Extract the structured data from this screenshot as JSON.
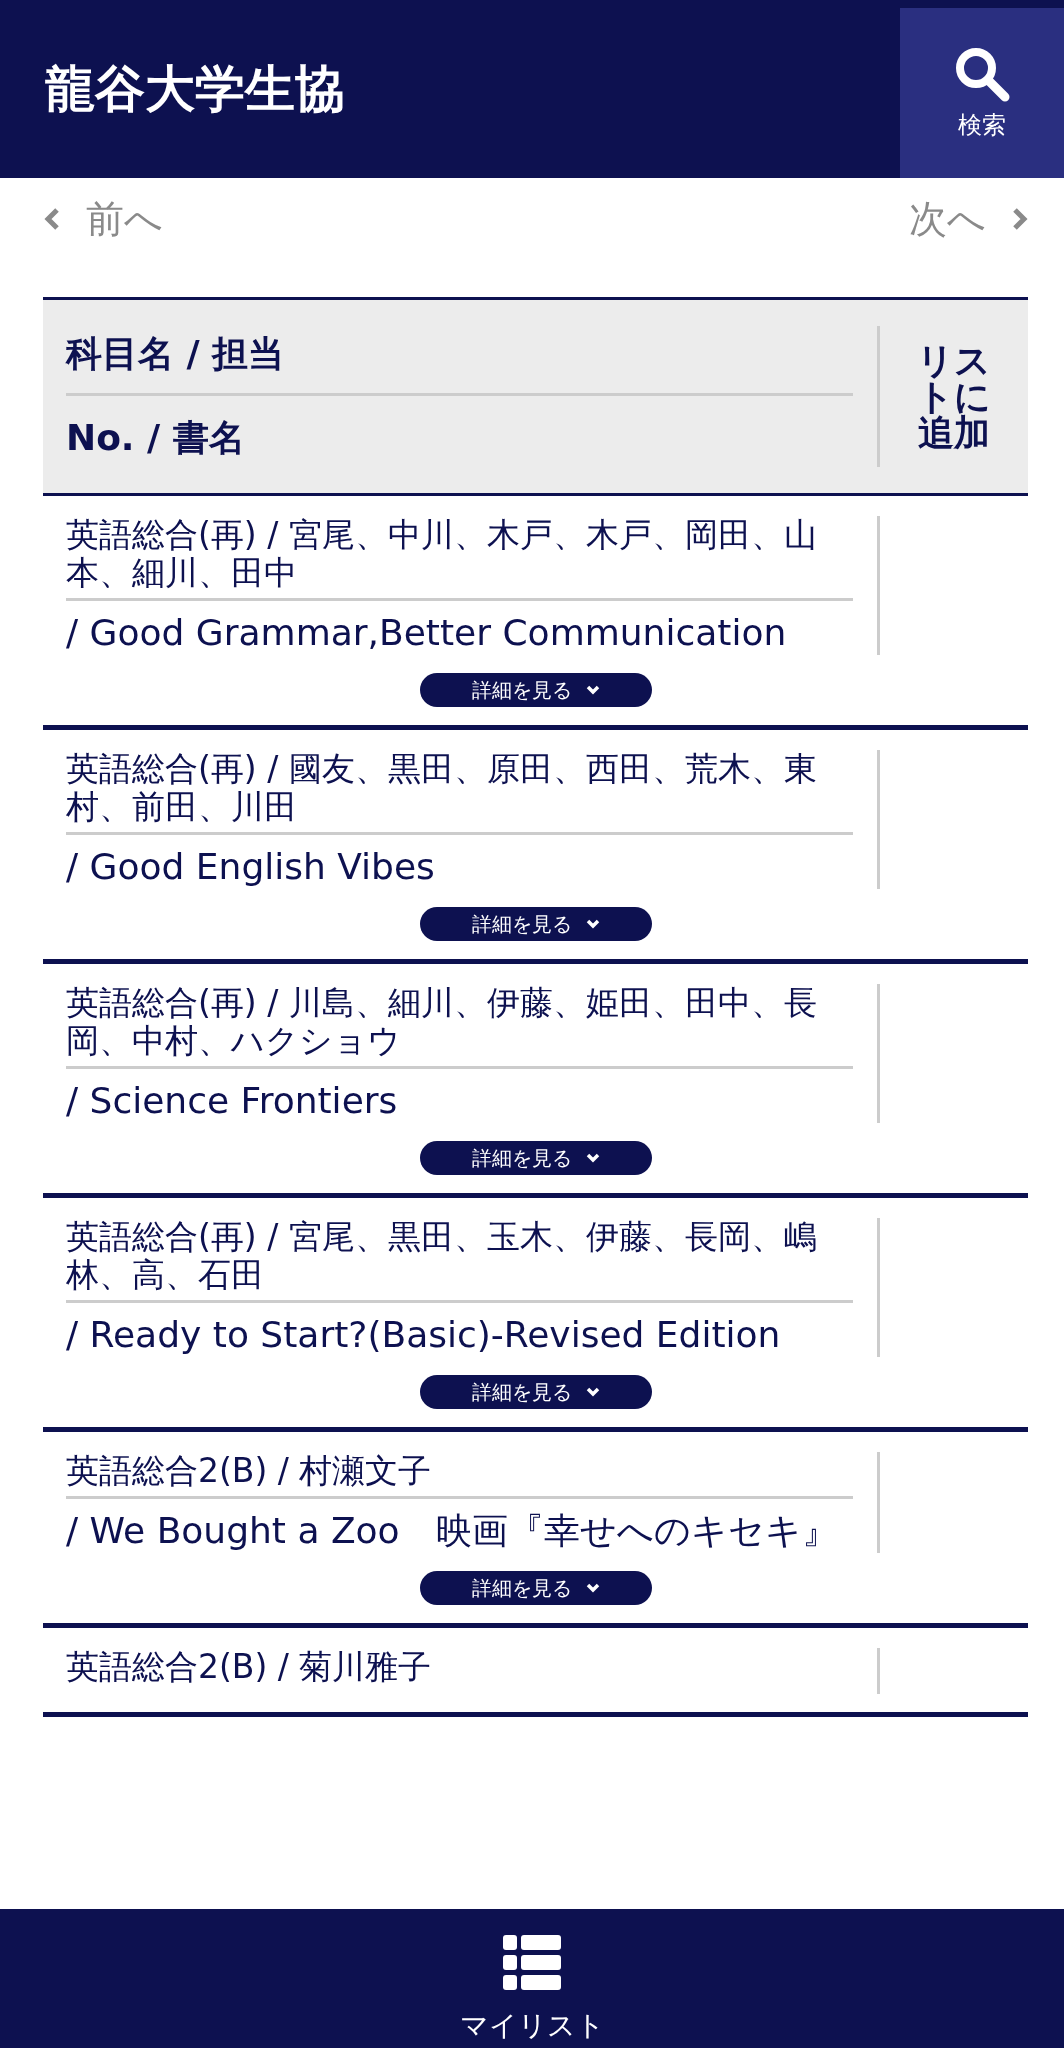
{
  "header": {
    "title": "龍谷大学生協",
    "search_label": "検索"
  },
  "pager": {
    "prev": "前へ",
    "next": "次へ"
  },
  "table": {
    "columns": [
      "科目名 / 担当",
      "No. / 書名",
      "リストに追加"
    ],
    "rows": [
      {
        "subject": "英語総合(再) / 宮尾、中川、木戸、木戸、岡田、山本、細川、田中",
        "title": "/ Good Grammar,Better Communication",
        "details": "詳細を見る"
      },
      {
        "subject": "英語総合(再) / 國友、黒田、原田、西田、荒木、東村、前田、川田",
        "title": "/ Good English Vibes",
        "details": "詳細を見る"
      },
      {
        "subject": "英語総合(再) / 川島、細川、伊藤、姫田、田中、長岡、中村、ハクショウ",
        "title": "/ Science Frontiers",
        "details": "詳細を見る"
      },
      {
        "subject": "英語総合(再) / 宮尾、黒田、玉木、伊藤、長岡、嶋林、高、石田",
        "title": "/ Ready to Start?(Basic)-Revised Edition",
        "details": "詳細を見る"
      },
      {
        "subject": "英語総合2(B) / 村瀬文子",
        "title": "/ We Bought a Zoo　映画『幸せへのキセキ』",
        "details": "詳細を見る"
      },
      {
        "subject": "英語総合2(B) / 菊川雅子"
      }
    ]
  },
  "bottom_nav": {
    "label": "マイリスト"
  }
}
